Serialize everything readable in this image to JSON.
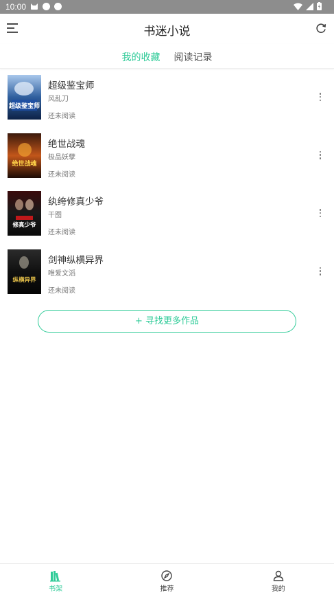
{
  "status_bar": {
    "time": "10:00"
  },
  "app_bar": {
    "title": "书迷小说"
  },
  "tabs": [
    {
      "label": "我的收藏",
      "active": true
    },
    {
      "label": "阅读记录",
      "active": false
    }
  ],
  "books": [
    {
      "title": "超级鉴宝师",
      "author": "风乱刀",
      "status": "还未阅读",
      "cover_text": "超级鉴宝师"
    },
    {
      "title": "绝世战魂",
      "author": "极品妖孽",
      "status": "还未阅读",
      "cover_text": "绝世战魂"
    },
    {
      "title": "纨绔修真少爷",
      "author": "干图",
      "status": "还未阅读",
      "cover_text": "修真少爷"
    },
    {
      "title": "剑神纵横异界",
      "author": "唯爱文滔",
      "status": "还未阅读",
      "cover_text": "纵横异界"
    }
  ],
  "find_more": {
    "label": "+ 寻找更多作品"
  },
  "bottom_nav": [
    {
      "label": "书架",
      "icon": "bookshelf-icon",
      "active": true
    },
    {
      "label": "推荐",
      "icon": "compass-icon",
      "active": false
    },
    {
      "label": "我的",
      "icon": "user-icon",
      "active": false
    }
  ],
  "colors": {
    "accent": "#2fcb98",
    "status_bar": "#8d8d8d"
  }
}
